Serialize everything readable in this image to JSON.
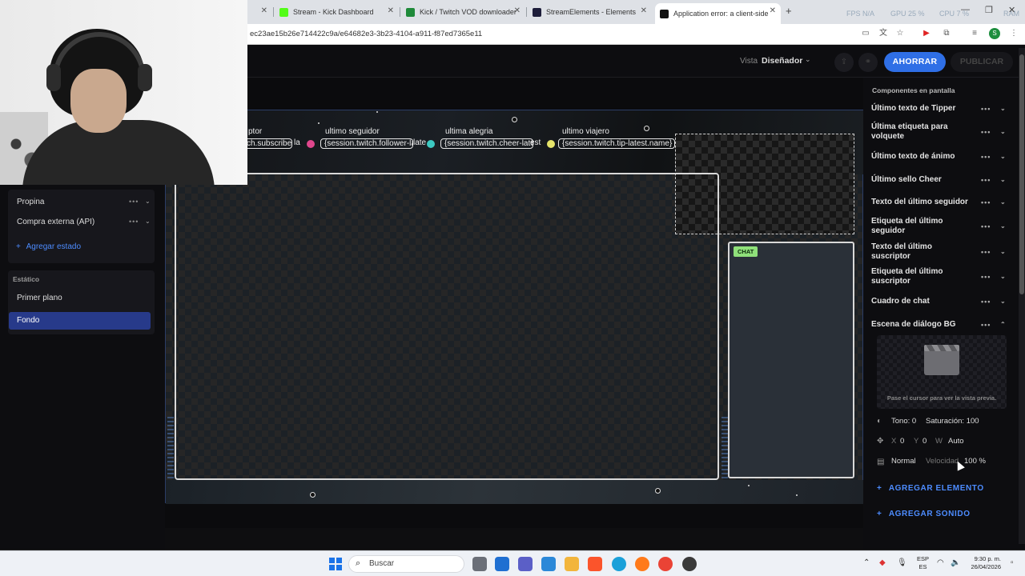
{
  "browser": {
    "tabs": [
      {
        "title": "",
        "closable": true
      },
      {
        "title": "Stream - Kick Dashboard",
        "fav_color": "#53fc18"
      },
      {
        "title": "Kick / Twitch VOD downloader",
        "fav_color": "#1f8a3a"
      },
      {
        "title": "StreamElements - Elements",
        "fav_color": "#1d1d3a"
      },
      {
        "title": "Application error: a client-side",
        "fav_color": "#111111"
      }
    ],
    "new_tab": "+",
    "sysmon": {
      "fps": "FPS N/A",
      "gpu": "GPU 25 %",
      "cpu": "CPU 7 %",
      "ram": "RAM"
    },
    "url": "ec23ae15b26e714422c9a/e64682e3-3b23-4104-a911-f87ed7365e11",
    "profile_initial": "S"
  },
  "header": {
    "vista_label": "Vista",
    "vista_value": "Diseñador",
    "save_label": "AHORRAR",
    "publish_label": "PUBLICAR"
  },
  "left": {
    "group_items": [
      {
        "label": "Propina"
      },
      {
        "label": "Compra externa (API)"
      }
    ],
    "add_state": "Agregar estado",
    "static_title": "Estático",
    "static_items": [
      {
        "label": "Primer plano",
        "selected": false
      },
      {
        "label": "Fondo",
        "selected": true
      }
    ]
  },
  "canvas": {
    "ticker": [
      {
        "label": "ptor",
        "value": "ch.subscriber-latest"
      },
      {
        "label": "ultimo seguidor",
        "value": "{session.twitch.follower-latest"
      },
      {
        "label": "ultima alegria",
        "value": "{session.twitch.cheer-latest}"
      },
      {
        "label": "ultimo viajero",
        "value": "{session.twitch.tip-latest.name}"
      }
    ],
    "separator_fragments": [
      "la",
      "late",
      "est"
    ],
    "chat_tag": "CHAT"
  },
  "right": {
    "title": "Componentes en pantalla",
    "components": [
      {
        "label": "Último texto de Tipper",
        "expanded": false
      },
      {
        "label": "Última etiqueta para volquete",
        "expanded": false
      },
      {
        "label": "Último texto de ánimo",
        "expanded": false
      },
      {
        "label": "Último sello Cheer",
        "expanded": false
      },
      {
        "label": "Texto del último seguidor",
        "expanded": false
      },
      {
        "label": "Etiqueta del último seguidor",
        "expanded": false
      },
      {
        "label": "Texto del último suscriptor",
        "expanded": false
      },
      {
        "label": "Etiqueta del último suscriptor",
        "expanded": false
      },
      {
        "label": "Cuadro de chat",
        "expanded": false
      },
      {
        "label": "Escena de diálogo BG",
        "expanded": true
      }
    ],
    "preview_hint": "Pase el cursor para ver la vista previa.",
    "props": {
      "tono": "Tono: 0",
      "saturacion": "Saturación: 100",
      "x_label": "X",
      "x_value": "0",
      "y_label": "Y",
      "y_value": "0",
      "w_label": "W",
      "w_value": "Auto",
      "blend": "Normal",
      "speed_label": "Velocidad",
      "speed_value": "100 %"
    },
    "add_element": "AGREGAR ELEMENTO",
    "add_sound": "AGREGAR SONIDO"
  },
  "taskbar": {
    "search": "Buscar",
    "lang_line1": "ESP",
    "lang_line2": "ES",
    "time": "9:30 p. m.",
    "date": "26/04/2026"
  }
}
